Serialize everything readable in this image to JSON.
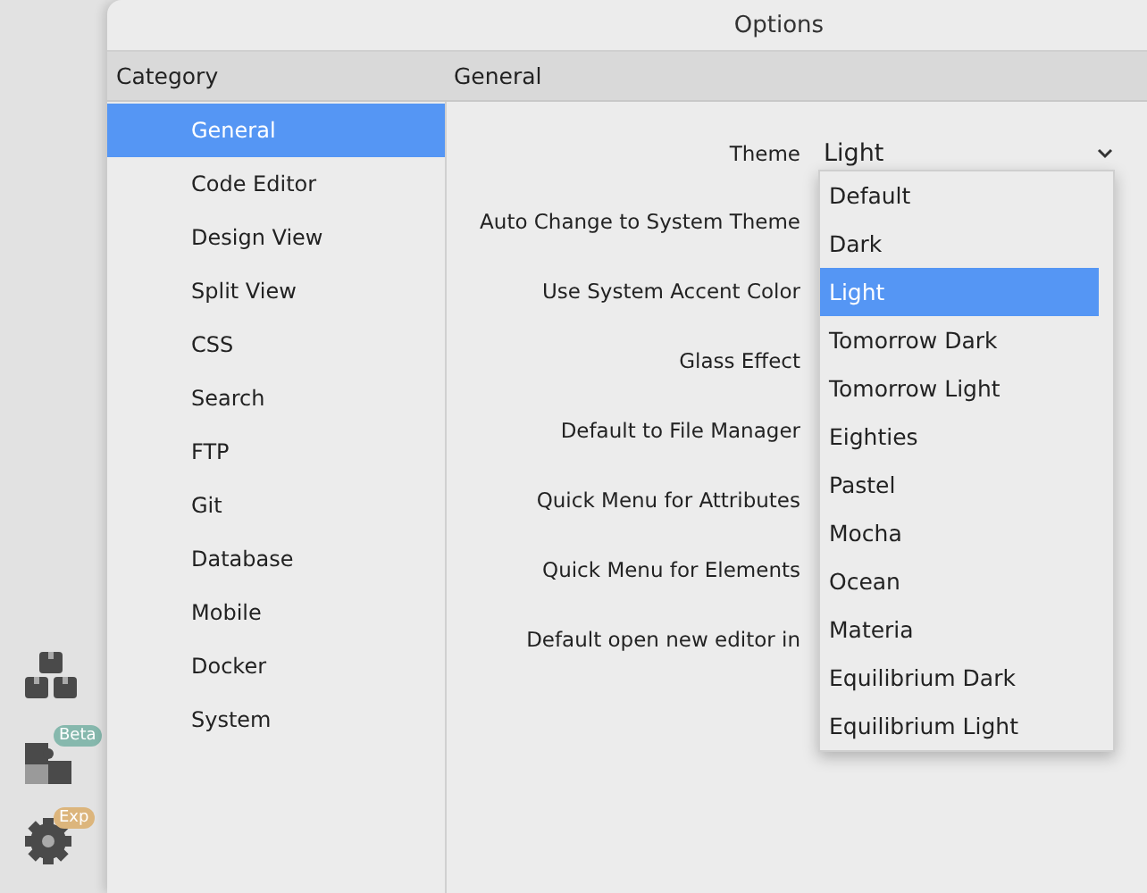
{
  "window": {
    "title": "Options"
  },
  "headers": {
    "category": "Category",
    "section": "General"
  },
  "categories": [
    {
      "label": "General",
      "selected": true
    },
    {
      "label": "Code Editor",
      "selected": false
    },
    {
      "label": "Design View",
      "selected": false
    },
    {
      "label": "Split View",
      "selected": false
    },
    {
      "label": "CSS",
      "selected": false
    },
    {
      "label": "Search",
      "selected": false
    },
    {
      "label": "FTP",
      "selected": false
    },
    {
      "label": "Git",
      "selected": false
    },
    {
      "label": "Database",
      "selected": false
    },
    {
      "label": "Mobile",
      "selected": false
    },
    {
      "label": "Docker",
      "selected": false
    },
    {
      "label": "System",
      "selected": false
    }
  ],
  "settings": [
    {
      "label": "Theme",
      "value": "Light"
    },
    {
      "label": "Auto Change to System Theme"
    },
    {
      "label": "Use System Accent Color"
    },
    {
      "label": "Glass Effect"
    },
    {
      "label": "Default to File Manager"
    },
    {
      "label": "Quick Menu for Attributes"
    },
    {
      "label": "Quick Menu for Elements"
    },
    {
      "label": "Default open new editor in"
    }
  ],
  "theme_menu": [
    {
      "label": "Default",
      "selected": false
    },
    {
      "label": "Dark",
      "selected": false
    },
    {
      "label": "Light",
      "selected": true
    },
    {
      "label": "Tomorrow Dark",
      "selected": false
    },
    {
      "label": "Tomorrow Light",
      "selected": false
    },
    {
      "label": "Eighties",
      "selected": false
    },
    {
      "label": "Pastel",
      "selected": false
    },
    {
      "label": "Mocha",
      "selected": false
    },
    {
      "label": "Ocean",
      "selected": false
    },
    {
      "label": "Materia",
      "selected": false
    },
    {
      "label": "Equilibrium Dark",
      "selected": false
    },
    {
      "label": "Equilibrium Light",
      "selected": false
    }
  ],
  "dock": [
    {
      "kind": "boxes"
    },
    {
      "kind": "puzzle",
      "badge": "Beta",
      "color": "#86b8ad"
    },
    {
      "kind": "gear",
      "badge": "Exp",
      "color": "#dcb57c"
    }
  ]
}
